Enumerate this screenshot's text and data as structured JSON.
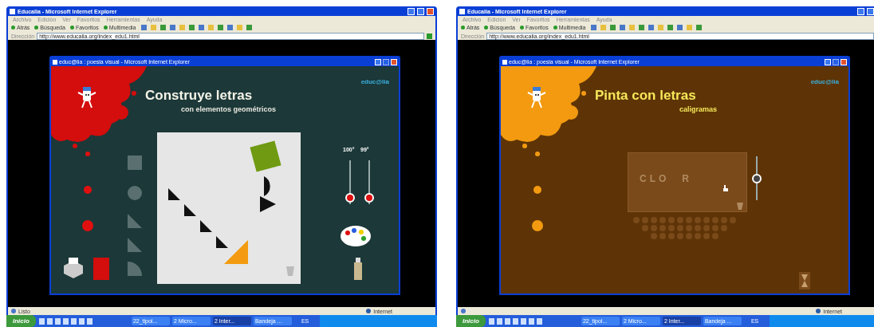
{
  "screens": [
    {
      "browser": {
        "title": "Educalia - Microsoft Internet Explorer",
        "menu": [
          "Archivo",
          "Edición",
          "Ver",
          "Favoritos",
          "Herramientas",
          "Ayuda"
        ],
        "toolbar": [
          "Atrás",
          "Búsqueda",
          "Favoritos",
          "Multimedia"
        ],
        "address_label": "Dirección",
        "url": "http://www.educalia.org/index_edu1.html"
      },
      "popup": {
        "kind": "geometry",
        "title": "educ@lia : poesia visual - Microsoft Internet Explorer",
        "logo": "educ@lia",
        "heading": "Construye letras",
        "subheading": "con elementos geométricos",
        "readings": [
          "100°",
          "99°"
        ],
        "sliders": [
          {
            "level": 0.15
          },
          {
            "level": 0.15
          }
        ]
      },
      "status": {
        "text": "Listo",
        "zone": "Internet"
      },
      "taskbar": {
        "start": "Inicio",
        "tasks": [
          {
            "label": "22_tipol...",
            "selected": false
          },
          {
            "label": "2 Micro...",
            "selected": false
          },
          {
            "label": "2 Inter...",
            "selected": true
          },
          {
            "label": "Bandeja ...",
            "selected": false
          }
        ],
        "language": "ES"
      }
    },
    {
      "browser": {
        "title": "Educalia - Microsoft Internet Explorer",
        "menu": [
          "Archivo",
          "Edición",
          "Ver",
          "Favoritos",
          "Herramientas",
          "Ayuda"
        ],
        "toolbar": [
          "Atrás",
          "Búsqueda",
          "Favoritos",
          "Multimedia"
        ],
        "address_label": "Dirección",
        "url": "http://www.educalia.org/index_edu1.html"
      },
      "popup": {
        "kind": "caligrama",
        "title": "educ@lia : poesia visual - Microsoft Internet Explorer",
        "logo": "educ@lia",
        "heading": "Pinta con letras",
        "subheading": "caligramas",
        "letters": [
          "C",
          "L",
          "O",
          "R"
        ],
        "sliders": [
          {
            "level": 0.5
          }
        ]
      },
      "status": {
        "zone": "Internet"
      },
      "taskbar": {
        "start": "Inicio",
        "tasks": [
          {
            "label": "22_tipol...",
            "selected": false
          },
          {
            "label": "2 Micro...",
            "selected": false
          },
          {
            "label": "2 Inter...",
            "selected": true
          },
          {
            "label": "Bandeja ...",
            "selected": false
          }
        ],
        "language": "ES"
      }
    }
  ]
}
